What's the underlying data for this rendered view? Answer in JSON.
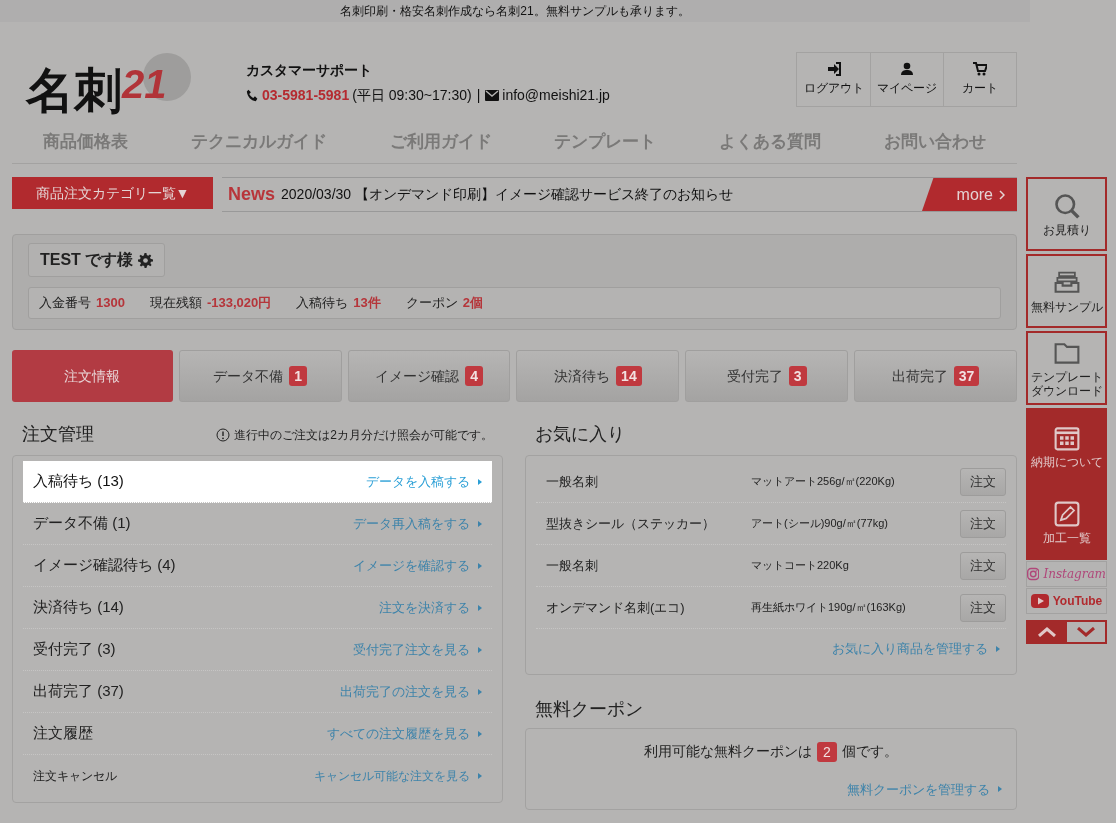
{
  "top_bar": {
    "text": "名刺印刷・格安名刺作成なら名刺21。無料サンプルも承ります。"
  },
  "logo": {
    "name": "名刺",
    "number": "21"
  },
  "support": {
    "title": "カスタマーサポート",
    "phone": "03-5981-5981",
    "hours": "(平日 09:30~17:30)",
    "separator": "|",
    "email": "info@meishi21.jp"
  },
  "header_buttons": [
    {
      "label": "ログアウト"
    },
    {
      "label": "マイページ"
    },
    {
      "label": "カート"
    }
  ],
  "nav": [
    "商品価格表",
    "テクニカルガイド",
    "ご利用ガイド",
    "テンプレート",
    "よくある質問",
    "お問い合わせ"
  ],
  "category_button": "商品注文カテゴリ一覧▼",
  "news": {
    "label": "News",
    "text": "2020/03/30 【オンデマンド印刷】イメージ確認サービス終了のお知らせ",
    "more": "more"
  },
  "account": {
    "name": "TEST です様",
    "stats": [
      {
        "label": "入金番号",
        "value": "1300"
      },
      {
        "label": "現在残額",
        "value": "-133,020円"
      },
      {
        "label": "入稿待ち",
        "value": "13件"
      },
      {
        "label": "クーポン",
        "value": "2個"
      }
    ]
  },
  "tabs": [
    {
      "label": "注文情報",
      "selected": true
    },
    {
      "label": "データ不備",
      "count": "1",
      "selected": false
    },
    {
      "label": "イメージ確認",
      "count": "4",
      "selected": false
    },
    {
      "label": "決済待ち",
      "count": "14",
      "selected": false
    },
    {
      "label": "受付完了",
      "count": "3",
      "selected": false
    },
    {
      "label": "出荷完了",
      "count": "37",
      "selected": false
    }
  ],
  "orders": {
    "title": "注文管理",
    "notice": "進行中のご注文は2カ月分だけ照会が可能です。",
    "rows": [
      {
        "kind": "normal",
        "label": "入稿待ち (13)",
        "link": "データを入稿する",
        "highlighted": true
      },
      {
        "kind": "normal",
        "label": "データ不備 (1)",
        "link": "データ再入稿をする",
        "highlighted": false
      },
      {
        "kind": "normal",
        "label": "イメージ確認待ち (4)",
        "link": "イメージを確認する",
        "highlighted": false
      },
      {
        "kind": "normal",
        "label": "決済待ち (14)",
        "link": "注文を決済する",
        "highlighted": false
      },
      {
        "kind": "normal",
        "label": "受付完了 (3)",
        "link": "受付完了注文を見る",
        "highlighted": false
      },
      {
        "kind": "normal",
        "label": "出荷完了 (37)",
        "link": "出荷完了の注文を見る",
        "highlighted": false
      },
      {
        "kind": "normal",
        "label": "注文履歴",
        "link": "すべての注文履歴を見る",
        "highlighted": false
      },
      {
        "kind": "small",
        "label": "注文キャンセル",
        "link": "キャンセル可能な注文を見る",
        "highlighted": false
      }
    ]
  },
  "favorites": {
    "title": "お気に入り",
    "items": [
      {
        "name": "一般名刺",
        "spec": "マットアート256g/㎡(220Kg)",
        "button": "注文"
      },
      {
        "name": "型抜きシール（ステッカー）",
        "spec": "アート(シール)90g/㎡(77kg)",
        "button": "注文"
      },
      {
        "name": "一般名刺",
        "spec": "マットコート220Kg",
        "button": "注文"
      },
      {
        "name": "オンデマンド名刺(エコ)",
        "spec": "再生紙ホワイト190g/㎡(163Kg)",
        "button": "注文"
      }
    ],
    "manage_link": "お気に入り商品を管理する"
  },
  "coupon": {
    "title": "無料クーポン",
    "before": "利用可能な無料クーポンは",
    "count": "2",
    "after": "個です。",
    "manage_link": "無料クーポンを管理する"
  },
  "side_menu": {
    "items": [
      {
        "kind": "light",
        "label": "お見積り"
      },
      {
        "kind": "light",
        "label": "無料サンプル"
      },
      {
        "kind": "light",
        "label": "テンプレートダウンロード"
      },
      {
        "kind": "red",
        "label": "納期について"
      },
      {
        "kind": "red",
        "label": "加工一覧"
      }
    ],
    "social": [
      "Instagram",
      "YouTube"
    ]
  }
}
